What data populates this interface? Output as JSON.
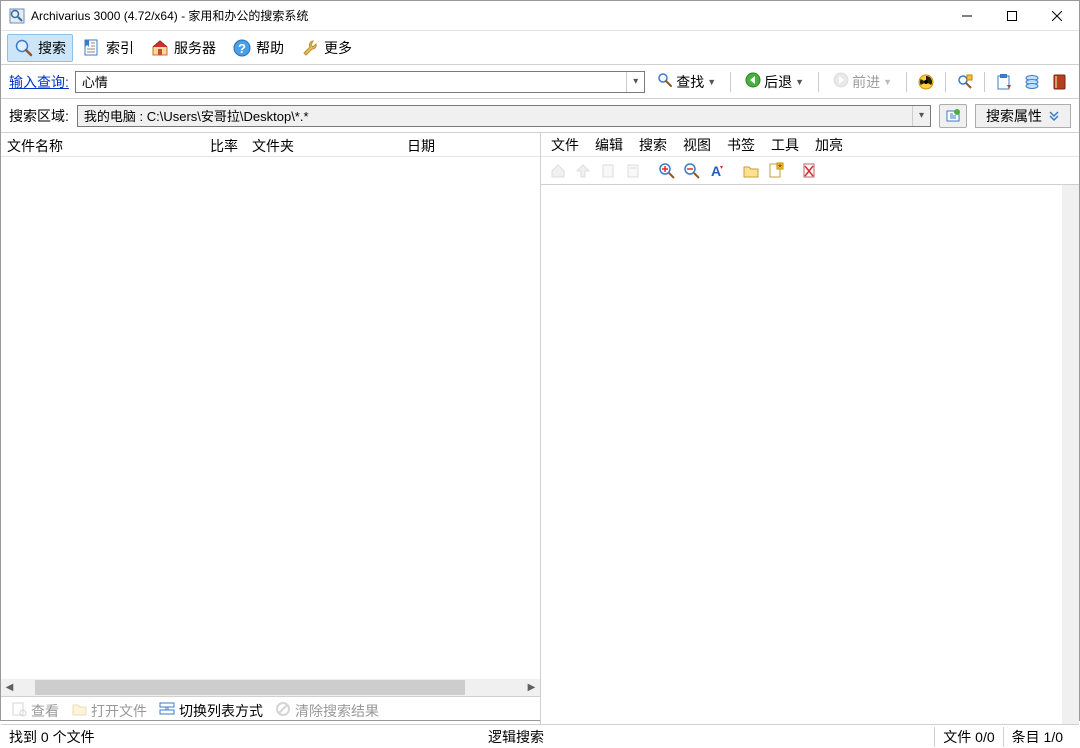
{
  "titlebar": {
    "title": "Archivarius 3000 (4.72/x64) - 家用和办公的搜索系统"
  },
  "main_toolbar": {
    "search": "搜索",
    "index": "索引",
    "server": "服务器",
    "help": "帮助",
    "more": "更多"
  },
  "querybar": {
    "label": "输入查询:",
    "query": "心情",
    "find": "查找",
    "back": "后退",
    "forward": "前进"
  },
  "areabar": {
    "label": "搜索区域:",
    "value": "我的电脑 : C:\\Users\\安哥拉\\Desktop\\*.*",
    "properties": "搜索属性"
  },
  "columns": {
    "filename": "文件名称",
    "ratio": "比率",
    "folder": "文件夹",
    "date": "日期"
  },
  "left_toolbar": {
    "view": "查看",
    "open_file": "打开文件",
    "toggle_list": "切换列表方式",
    "clear_results": "清除搜索结果"
  },
  "preview_menu": {
    "file": "文件",
    "edit": "编辑",
    "search": "搜索",
    "view": "视图",
    "bookmark": "书签",
    "tools": "工具",
    "highlight": "加亮"
  },
  "statusbar": {
    "found": "找到 0 个文件",
    "mode": "逻辑搜索",
    "files": "文件 0/0",
    "entries": "条目 1/0"
  }
}
